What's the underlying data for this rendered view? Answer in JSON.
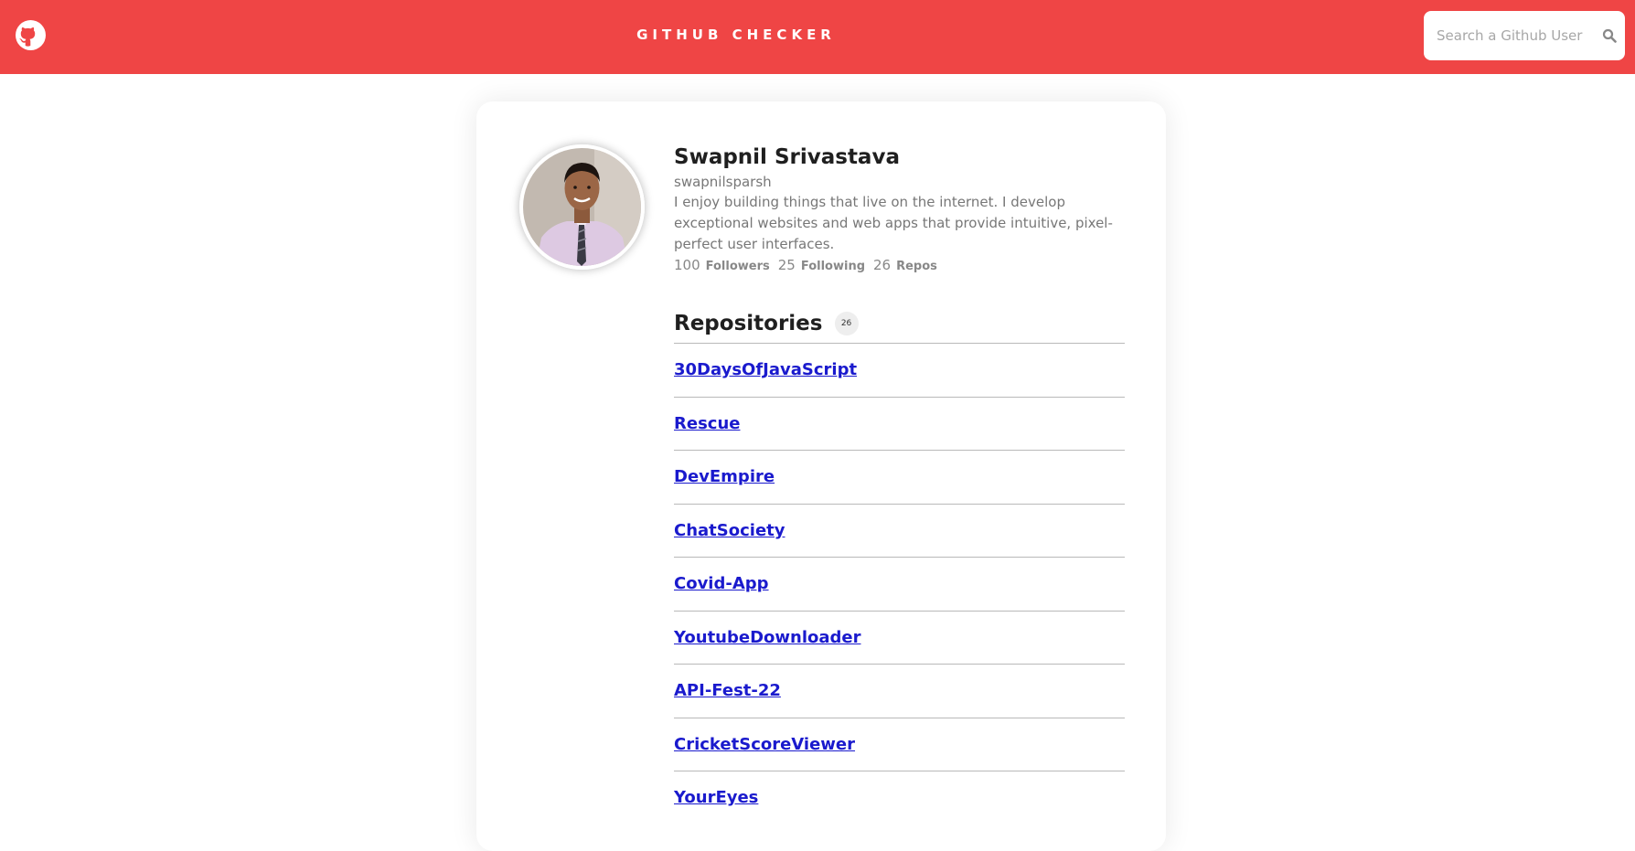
{
  "header": {
    "title": "GITHUB CHECKER",
    "logo_icon": "github-icon",
    "brand_color": "#ef4545"
  },
  "search": {
    "placeholder": "Search a Github User",
    "value": "",
    "icon": "search-icon"
  },
  "profile": {
    "name": "Swapnil Srivastava",
    "login": "swapnilsparsh",
    "bio": "I enjoy building things that live on the internet. I develop exceptional websites and web apps that provide intuitive, pixel-perfect user interfaces.",
    "followers_count": "100",
    "followers_label": "Followers",
    "following_count": "25",
    "following_label": "Following",
    "repos_count": "26",
    "repos_label": "Repos"
  },
  "repositories": {
    "title": "Repositories",
    "badge": "26",
    "items": [
      {
        "name": "30DaysOfJavaScript"
      },
      {
        "name": "Rescue"
      },
      {
        "name": "DevEmpire"
      },
      {
        "name": "ChatSociety"
      },
      {
        "name": "Covid-App"
      },
      {
        "name": "YoutubeDownloader"
      },
      {
        "name": "API-Fest-22"
      },
      {
        "name": "CricketScoreViewer"
      },
      {
        "name": "YourEyes"
      }
    ]
  }
}
